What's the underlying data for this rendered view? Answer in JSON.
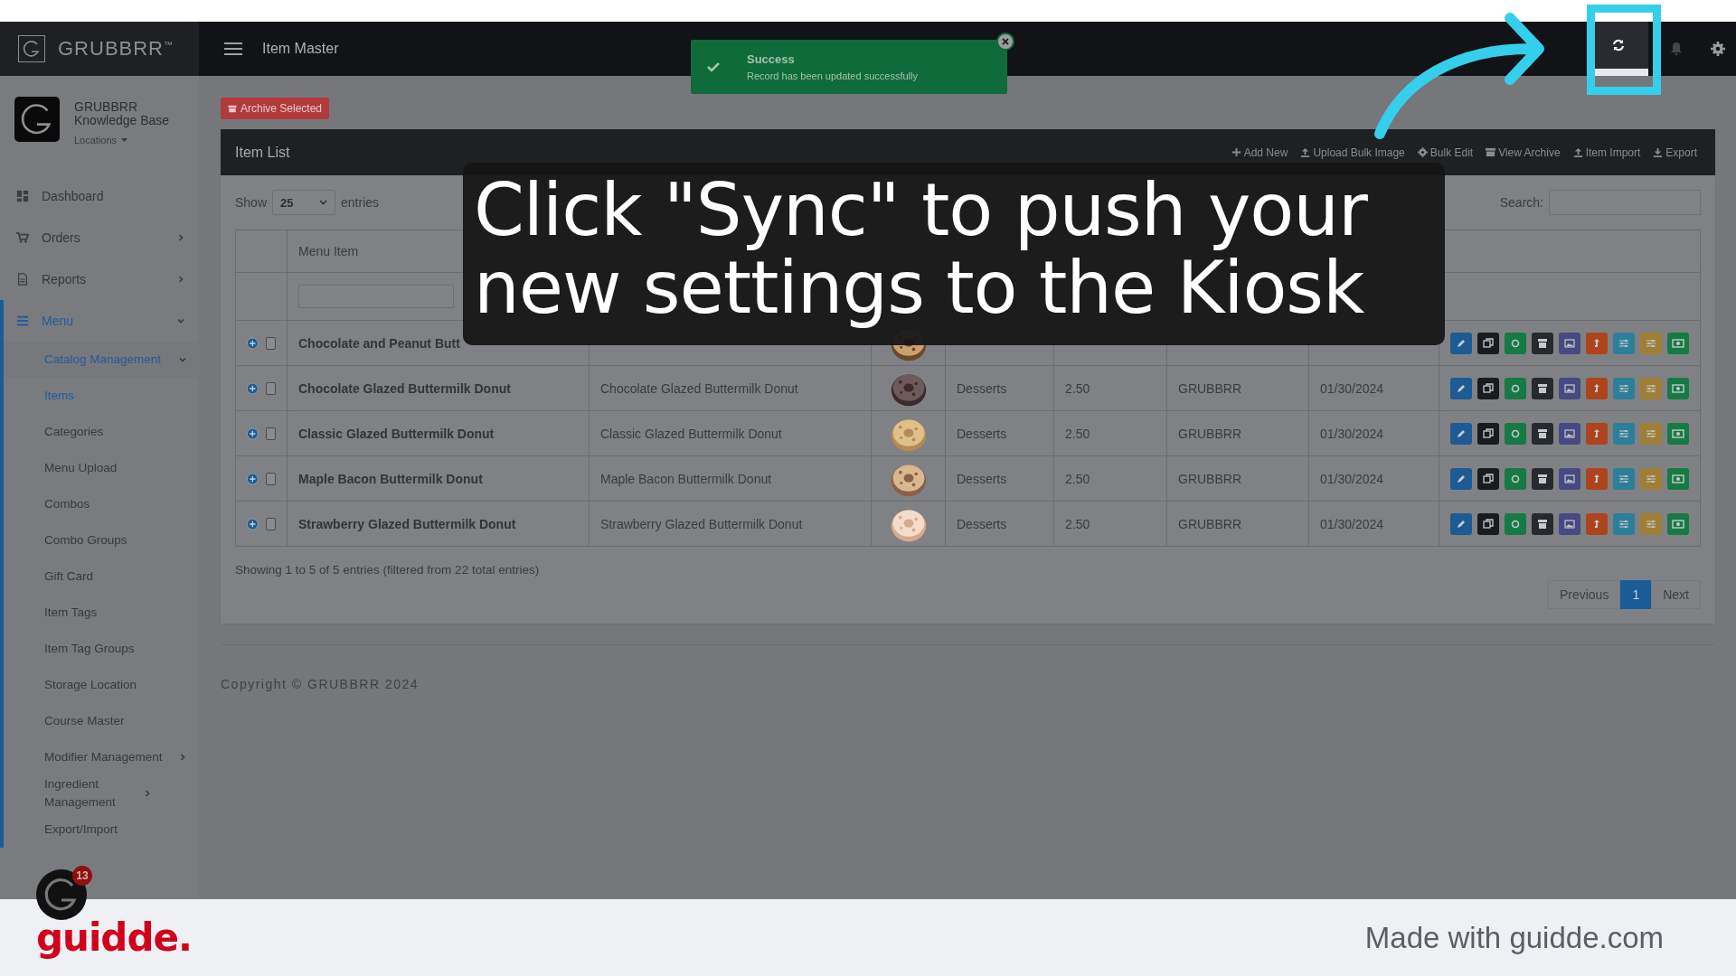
{
  "logo": "GRUBBRR$^{™}$",
  "account": {
    "name": "GRUBBRR Knowledge Base",
    "location_label": "Locations"
  },
  "sidebar": {
    "items": [
      {
        "label": "Dashboard",
        "selected": false
      },
      {
        "label": "Orders",
        "selected": false,
        "expanded": false
      },
      {
        "label": "Reports",
        "selected": false,
        "expanded": false
      },
      {
        "label": "Menu",
        "selected": true,
        "expanded": true,
        "children": [
          {
            "label": "Catalog Management",
            "selected": true,
            "expanded": true
          },
          {
            "label": "Items",
            "selected": true
          },
          {
            "label": "Categories",
            "selected": false
          },
          {
            "label": "Menu Upload",
            "selected": false
          },
          {
            "label": "Combos",
            "selected": false
          },
          {
            "label": "Combo Groups",
            "selected": false
          },
          {
            "label": "Gift Card",
            "selected": false
          },
          {
            "label": "Item Tags",
            "selected": false
          },
          {
            "label": "Item Tag Groups",
            "selected": false
          },
          {
            "label": "Storage Location",
            "selected": false
          },
          {
            "label": "Course Master",
            "selected": false
          },
          {
            "label": "Modifier Management",
            "selected": false,
            "expanded": false
          },
          {
            "label": "Ingredient Management",
            "selected": false,
            "expanded": false
          },
          {
            "label": "Export/Import",
            "selected": false
          }
        ]
      }
    ]
  },
  "chat_badge": "13",
  "header": {
    "title": "Item Master"
  },
  "toast": {
    "title": "Success",
    "message": "Record has been updated successfully"
  },
  "archive_button": "Archive Selected",
  "panel": {
    "title": "Item List",
    "actions": [
      "Add New",
      "Upload Bulk Image",
      "Bulk Edit",
      "View Archive",
      "Item Import",
      "Export"
    ]
  },
  "length": {
    "prefix": "Show",
    "value": "25",
    "suffix": "entries"
  },
  "search_label": "Search:",
  "table": {
    "columns": [
      "Menu Item"
    ],
    "rows": [
      {
        "checked": false,
        "menu_item": "Chocolate and Peanut Butt"
      },
      {
        "checked": false,
        "menu_item": "Chocolate Glazed Buttermilk Donut",
        "display_name": "Chocolate Glazed Buttermilk Donut",
        "category": "Desserts",
        "price": "2.50",
        "updated_by": "GRUBBRR",
        "updated_date": "01/30/2024"
      },
      {
        "checked": false,
        "menu_item": "Classic Glazed Buttermilk Donut",
        "display_name": "Classic Glazed Buttermilk Donut",
        "category": "Desserts",
        "price": "2.50",
        "updated_by": "GRUBBRR",
        "updated_date": "01/30/2024"
      },
      {
        "checked": false,
        "menu_item": "Maple Bacon Buttermilk Donut",
        "display_name": "Maple Bacon Buttermilk Donut",
        "category": "Desserts",
        "price": "2.50",
        "updated_by": "GRUBBRR",
        "updated_date": "01/30/2024"
      },
      {
        "checked": false,
        "menu_item": "Strawberry Glazed Buttermilk Donut",
        "display_name": "Strawberry Glazed Buttermilk Donut",
        "category": "Desserts",
        "price": "2.50",
        "updated_by": "GRUBBRR",
        "updated_date": "01/30/2024"
      }
    ]
  },
  "info": "Showing 1 to 5 of 5 entries (filtered from 22 total entries)",
  "pagination": [
    {
      "label": "Previous",
      "selected": false
    },
    {
      "label": "1",
      "selected": true
    },
    {
      "label": "Next",
      "selected": false
    }
  ],
  "copyright": "Copyright © GRUBBRR 2024",
  "caption": "Click \"Sync\" to push your new settings to the Kiosk",
  "footer": {
    "brand": "guidde.",
    "credit": "Made with guidde.com"
  }
}
